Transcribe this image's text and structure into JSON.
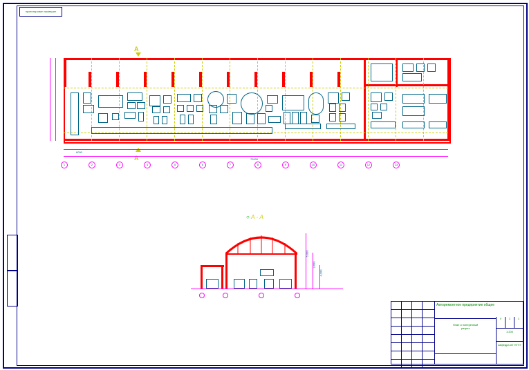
{
  "stamp": {
    "text": "проектировал проверил"
  },
  "plan": {
    "section_mark_top": "А",
    "section_mark_bottom": "А",
    "grid_labels": [
      "1",
      "2",
      "3",
      "4",
      "5",
      "6",
      "7",
      "8",
      "9",
      "10",
      "11",
      "12",
      "13"
    ],
    "dim_overall": "72000",
    "dim_bay": "6000"
  },
  "section": {
    "label": "А - А",
    "height_1": "6,000",
    "height_2": "3,600",
    "height_3": "4,200"
  },
  "title_block": {
    "project": "Авторемонтное предприятие общее",
    "drawing": "План и поперечный",
    "drawing2": "разрез",
    "stage": "У",
    "sheet": "1",
    "sheets": "1",
    "scale": "1:200",
    "org": "кафедра АТ НГТУ"
  }
}
